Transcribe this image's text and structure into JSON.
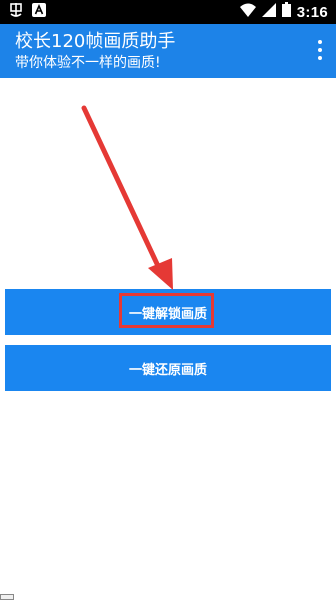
{
  "status_bar": {
    "time": "3:16",
    "icons": [
      "app-notification-icon",
      "a-notification-icon",
      "wifi-icon",
      "cell-signal-icon",
      "battery-icon"
    ]
  },
  "app_bar": {
    "title": "校长120帧画质助手",
    "subtitle": "带你体验不一样的画质!",
    "menu_icon": "overflow-menu-icon",
    "color": "#1d83e8"
  },
  "buttons": {
    "unlock_label": "一键解锁画质",
    "restore_label": "一键还原画质",
    "color": "#1a86f0"
  },
  "annotation": {
    "color": "#e53935",
    "arrow": "red-arrow-icon",
    "target": "unlock-button"
  }
}
